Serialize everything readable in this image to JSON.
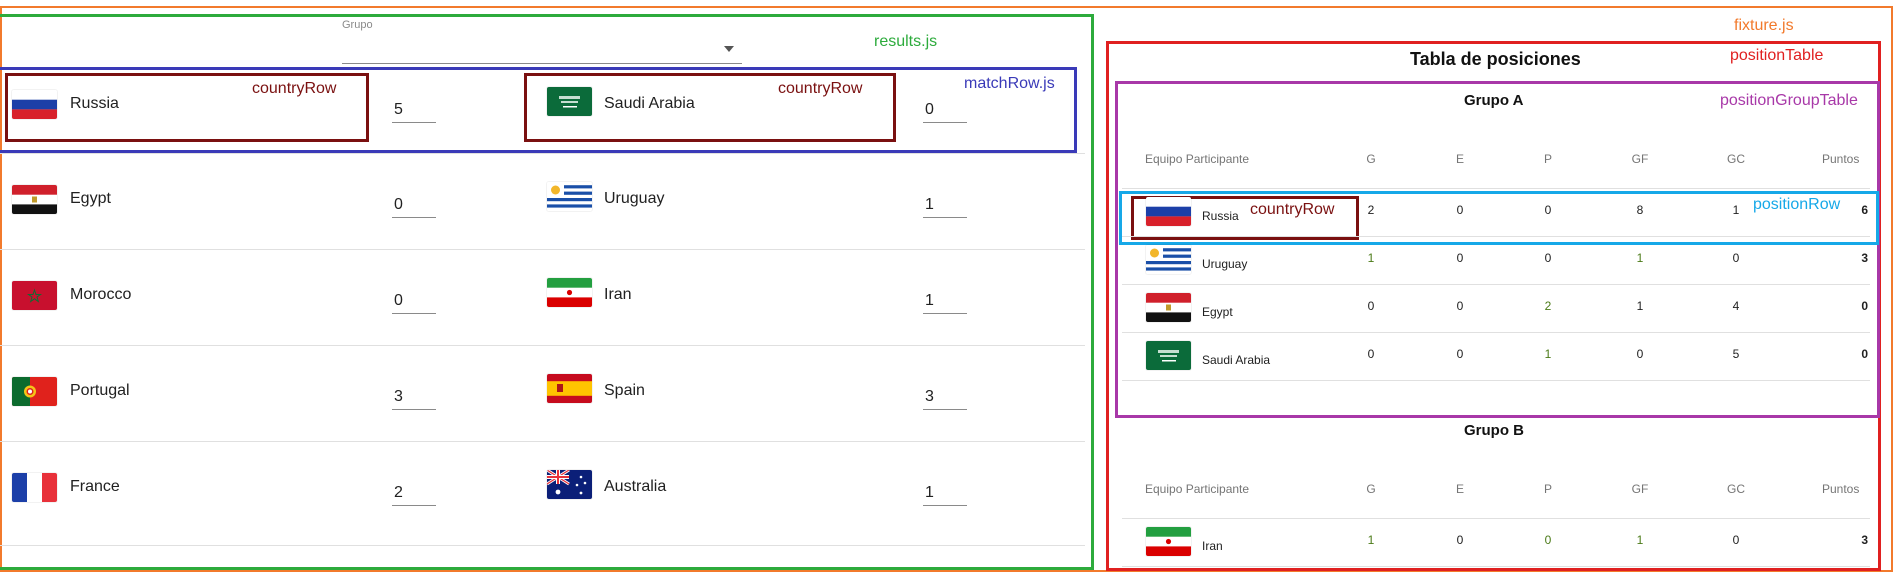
{
  "annotations": {
    "fixture": "fixture.js",
    "results": "results.js",
    "matchRow": "matchRow.js",
    "countryRow": "countryRow",
    "positionTable": "positionTable",
    "positionGroupTable": "positionGroupTable",
    "positionRow": "positionRow",
    "colors": {
      "fixture": "#f27a2c",
      "results": "#2dab3c",
      "matchRow": "#3a3ab8",
      "countryRow": "#7a1010",
      "positionTable": "#e02020",
      "positionGroupTable": "#a838a8",
      "positionRow": "#16a8e8"
    }
  },
  "filter": {
    "label": "Grupo",
    "value": ""
  },
  "matches": [
    {
      "home": {
        "name": "Russia",
        "flag": "russia"
      },
      "home_score": "5",
      "away": {
        "name": "Saudi Arabia",
        "flag": "saudi"
      },
      "away_score": "0"
    },
    {
      "home": {
        "name": "Egypt",
        "flag": "egypt"
      },
      "home_score": "0",
      "away": {
        "name": "Uruguay",
        "flag": "uruguay"
      },
      "away_score": "1"
    },
    {
      "home": {
        "name": "Morocco",
        "flag": "morocco"
      },
      "home_score": "0",
      "away": {
        "name": "Iran",
        "flag": "iran"
      },
      "away_score": "1"
    },
    {
      "home": {
        "name": "Portugal",
        "flag": "portugal"
      },
      "home_score": "3",
      "away": {
        "name": "Spain",
        "flag": "spain"
      },
      "away_score": "3"
    },
    {
      "home": {
        "name": "France",
        "flag": "france"
      },
      "home_score": "2",
      "away": {
        "name": "Australia",
        "flag": "australia"
      },
      "away_score": "1"
    }
  ],
  "position_table": {
    "title": "Tabla de posiciones",
    "headers": [
      "Equipo Participante",
      "G",
      "E",
      "P",
      "GF",
      "GC",
      "Puntos"
    ],
    "groups": [
      {
        "name": "Grupo A",
        "rows": [
          {
            "team": "Russia",
            "flag": "russia",
            "G": "2",
            "E": "0",
            "P": "0",
            "GF": "8",
            "GC": "1",
            "Puntos": "6"
          },
          {
            "team": "Uruguay",
            "flag": "uruguay",
            "G": "1",
            "E": "0",
            "P": "0",
            "GF": "1",
            "GC": "0",
            "Puntos": "3"
          },
          {
            "team": "Egypt",
            "flag": "egypt",
            "G": "0",
            "E": "0",
            "P": "2",
            "GF": "1",
            "GC": "4",
            "Puntos": "0"
          },
          {
            "team": "Saudi Arabia",
            "flag": "saudi",
            "G": "0",
            "E": "0",
            "P": "1",
            "GF": "0",
            "GC": "5",
            "Puntos": "0"
          }
        ]
      },
      {
        "name": "Grupo B",
        "rows": [
          {
            "team": "Iran",
            "flag": "iran",
            "G": "1",
            "E": "0",
            "P": "0",
            "GF": "1",
            "GC": "0",
            "Puntos": "3"
          }
        ]
      }
    ]
  }
}
